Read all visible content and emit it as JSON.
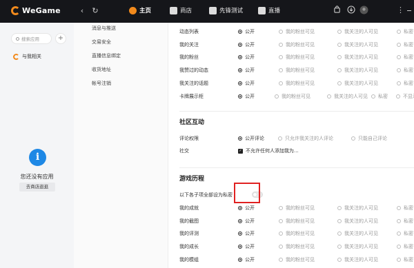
{
  "topbar": {
    "logo_text": "WeGame",
    "back_icon": "‹",
    "refresh_icon": "↻",
    "nav": [
      {
        "label": "主页",
        "active": true
      },
      {
        "label": "商店",
        "active": false
      },
      {
        "label": "先锋测试",
        "active": false
      },
      {
        "label": "直播",
        "active": false
      }
    ],
    "menu_icon": "⋮"
  },
  "sidebar": {
    "search_placeholder": "搜索应用",
    "add": "+",
    "related": "与我相关",
    "empty_icon": "i",
    "empty_text": "您还没有应用",
    "store_button": "去商店逛逛"
  },
  "menu": {
    "items": [
      "消息与推送",
      "交易安全",
      "直播信息绑定",
      "收货地址",
      "帐号注销"
    ]
  },
  "privacy_rows": [
    {
      "label": "动态列表",
      "options": [
        "公开",
        "我的粉丝可见",
        "我关注的人可见",
        "私密"
      ],
      "selected": 0
    },
    {
      "label": "我的关注",
      "options": [
        "公开",
        "我的粉丝可见",
        "我关注的人可见",
        "私密"
      ],
      "selected": 0
    },
    {
      "label": "我的粉丝",
      "options": [
        "公开",
        "我的粉丝可见",
        "我关注的人可见",
        "私密"
      ],
      "selected": 0
    },
    {
      "label": "我赞过的动态",
      "options": [
        "公开",
        "我的粉丝可见",
        "我关注的人可见",
        "私密"
      ],
      "selected": 0
    },
    {
      "label": "我关注的话题",
      "options": [
        "公开",
        "我的粉丝可见",
        "我关注的人可见",
        "私密"
      ],
      "selected": 0
    },
    {
      "label": "卡牌展示柜",
      "options": [
        "公开",
        "我的粉丝可见",
        "我关注的人可见",
        "私密",
        "不显示"
      ],
      "selected": 0
    }
  ],
  "community": {
    "title": "社区互动",
    "comment_label": "评论权限",
    "comment_options": [
      "公开评论",
      "只允许我关注的人评论",
      "只能自己评论"
    ],
    "comment_selected": 0,
    "social_label": "社交",
    "social_checkbox": "不允许任何人添加我为..."
  },
  "game_history": {
    "title": "游戏历程",
    "toggle_label": "以下各子项全部设为私密",
    "toggle_on": false,
    "rows": [
      {
        "label": "我的成就",
        "options": [
          "公开",
          "我的粉丝可见",
          "我关注的人可见",
          "私密"
        ],
        "selected": 0
      },
      {
        "label": "我的截图",
        "options": [
          "公开",
          "我的粉丝可见",
          "我关注的人可见",
          "私密"
        ],
        "selected": 0
      },
      {
        "label": "我的评测",
        "options": [
          "公开",
          "我的粉丝可见",
          "我关注的人可见",
          "私密"
        ],
        "selected": 0
      },
      {
        "label": "我的成长",
        "options": [
          "公开",
          "我的粉丝可见",
          "我关注的人可见",
          "私密"
        ],
        "selected": 0
      },
      {
        "label": "我的模组",
        "options": [
          "公开",
          "我的粉丝可见",
          "我关注的人可见",
          "私密"
        ],
        "selected": 0
      }
    ]
  },
  "colors": {
    "accent": "#f28a1c",
    "highlight": "#e02020",
    "topbar": "#15161a",
    "info": "#1e88e5"
  }
}
